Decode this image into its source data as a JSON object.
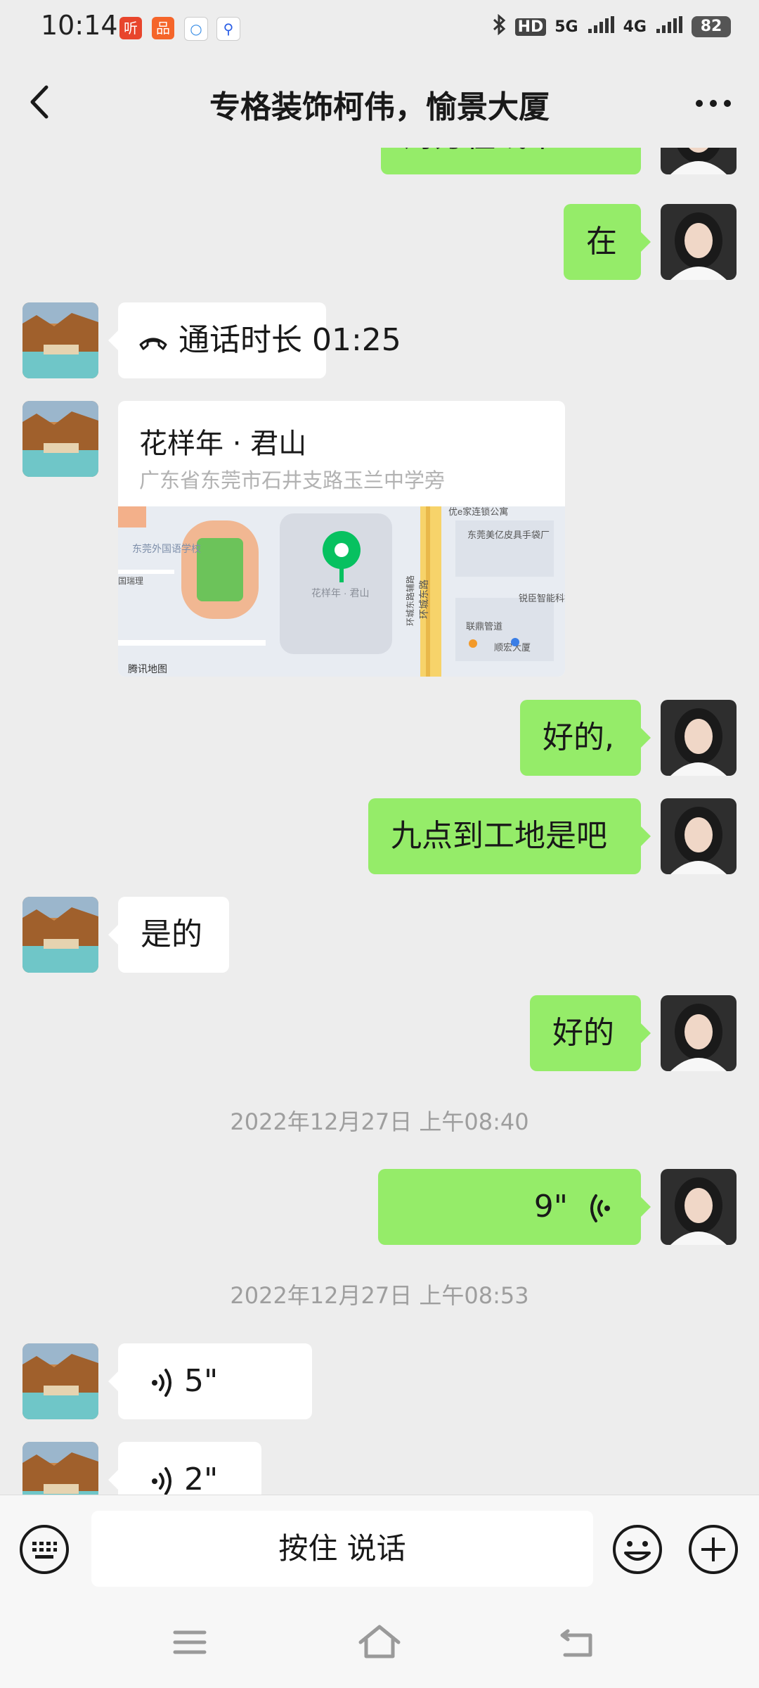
{
  "status_bar": {
    "time": "10:14",
    "notif_icons": [
      "听",
      "品",
      "○",
      "⚲"
    ],
    "network_hd": "HD",
    "network_5g": "5G",
    "network_4g": "4G",
    "battery": "82"
  },
  "header": {
    "title": "专格装饰柯伟，愉景大厦"
  },
  "messages": {
    "m0": {
      "text": "对方在线中",
      "side": "right"
    },
    "m1": {
      "text": "在",
      "side": "right"
    },
    "m2": {
      "text": "通话时长 01:25",
      "side": "left"
    },
    "m3": {
      "side": "left",
      "name": "花样年 · 君山",
      "address": "广东省东莞市石井支路玉兰中学旁",
      "map": {
        "labels": [
          "东莞外国语学校",
          "花样年 · 君山",
          "优e家连锁公寓",
          "东莞美亿皮具手袋厂",
          "锐臣智能科技",
          "联鼎管道",
          "顺宏大厦",
          "环城东路",
          "环城东路辅路",
          "国瑞理"
        ],
        "attribution": "腾讯地图"
      }
    },
    "m4": {
      "text": "好的,",
      "side": "right"
    },
    "m5": {
      "text": "九点到工地是吧",
      "side": "right"
    },
    "m6": {
      "text": "是的",
      "side": "left"
    },
    "m7": {
      "text": "好的",
      "side": "right"
    },
    "t1": {
      "text": "2022年12月27日 上午08:40"
    },
    "m8": {
      "text": "9\"",
      "side": "right",
      "type": "voice"
    },
    "t2": {
      "text": "2022年12月27日 上午08:53"
    },
    "m9": {
      "text": "5\"",
      "side": "left",
      "type": "voice"
    },
    "m10": {
      "text": "2\"",
      "side": "left",
      "type": "voice"
    }
  },
  "input_bar": {
    "hold_to_talk": "按住 说话"
  },
  "colors": {
    "background": "#ededed",
    "bubble_self": "#95ec69",
    "bubble_other": "#ffffff",
    "timestamp": "#9e9e9e",
    "map_pin": "#07c160"
  }
}
